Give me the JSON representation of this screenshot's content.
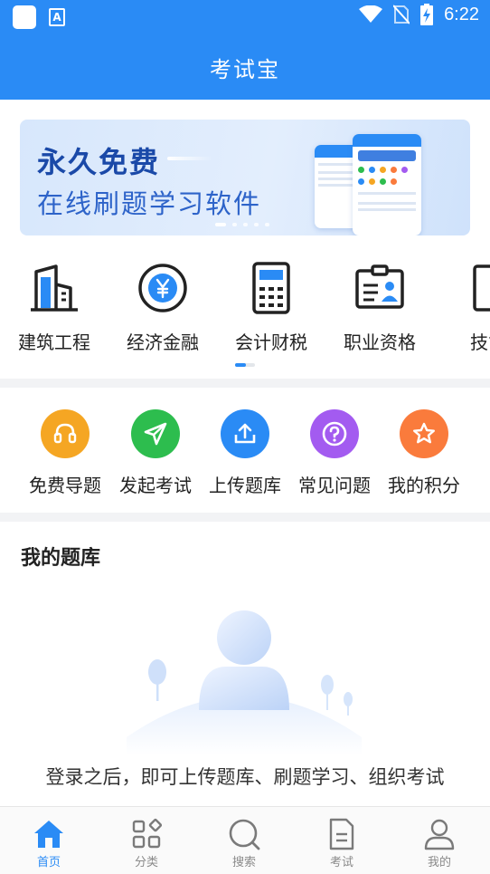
{
  "status_bar": {
    "time": "6:22",
    "app_icon_letter": "A"
  },
  "header": {
    "title": "考试宝"
  },
  "banner": {
    "headline": "永久免费",
    "subline": "在线刷题学习软件",
    "slide_count": 5,
    "active_slide": 1
  },
  "categories": [
    {
      "label": "建筑工程",
      "icon": "building-icon"
    },
    {
      "label": "经济金融",
      "icon": "yen-coin-icon"
    },
    {
      "label": "会计财税",
      "icon": "calculator-icon"
    },
    {
      "label": "职业资格",
      "icon": "certificate-icon"
    },
    {
      "label": "技能",
      "icon": "skill-icon"
    }
  ],
  "actions": [
    {
      "label": "免费导题",
      "icon": "headset-icon",
      "color": "#f5a623"
    },
    {
      "label": "发起考试",
      "icon": "send-icon",
      "color": "#2dbd4e"
    },
    {
      "label": "上传题库",
      "icon": "upload-icon",
      "color": "#2a8bf5"
    },
    {
      "label": "常见问题",
      "icon": "question-icon",
      "color": "#a35bf0"
    },
    {
      "label": "我的积分",
      "icon": "star-icon",
      "color": "#fa7b3c"
    }
  ],
  "my_bank": {
    "title": "我的题库",
    "empty_message": "登录之后，即可上传题库、刷题学习、组织考试"
  },
  "tabs": [
    {
      "label": "首页",
      "icon": "home-icon",
      "active": true
    },
    {
      "label": "分类",
      "icon": "grid-icon",
      "active": false
    },
    {
      "label": "搜索",
      "icon": "search-icon",
      "active": false
    },
    {
      "label": "考试",
      "icon": "document-icon",
      "active": false
    },
    {
      "label": "我的",
      "icon": "user-icon",
      "active": false
    }
  ],
  "colors": {
    "primary": "#2a8bf5",
    "banner_headline": "#1a49a8",
    "banner_subline": "#2d63c9",
    "tab_inactive": "#8a8a8a"
  }
}
